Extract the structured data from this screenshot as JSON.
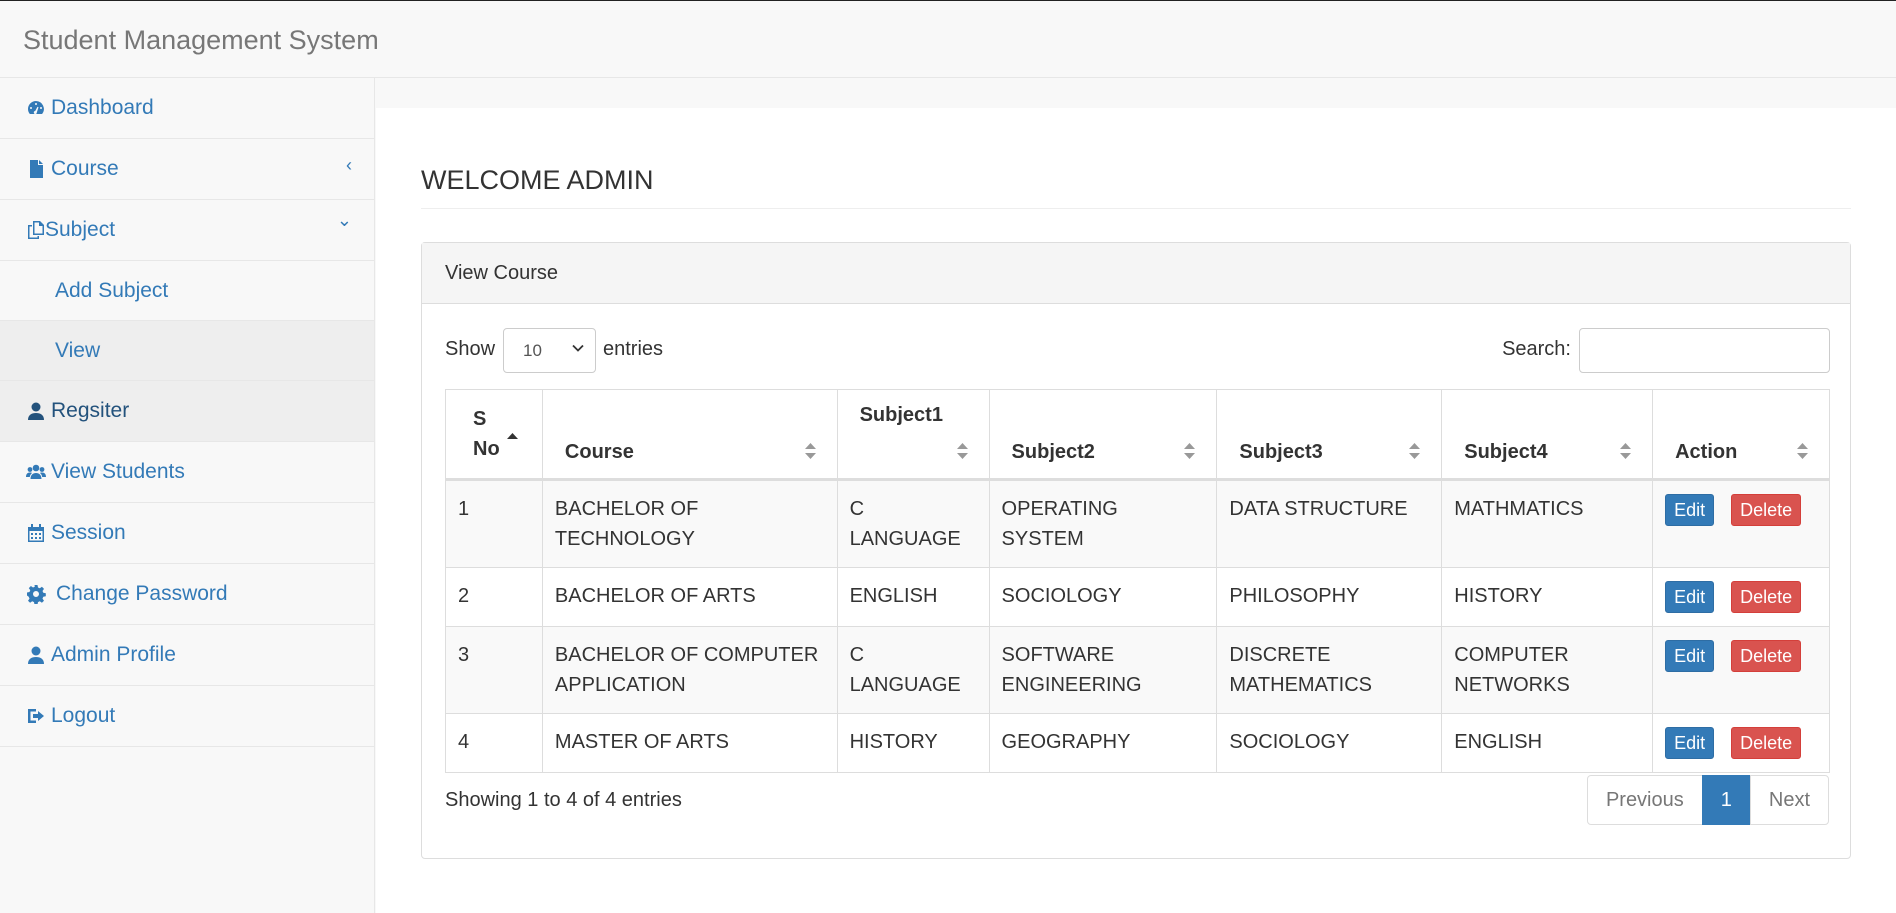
{
  "app": {
    "title": "Student Management System"
  },
  "sidebar": {
    "items": [
      {
        "label": "Dashboard",
        "icon": "dashboard-icon"
      },
      {
        "label": "Course",
        "icon": "file-icon",
        "arrow": "‹"
      },
      {
        "label": "Subject",
        "icon": "copy-icon",
        "arrow": "⌄"
      },
      {
        "label": "Regsiter",
        "icon": "user-icon"
      },
      {
        "label": "View Students",
        "icon": "users-icon"
      },
      {
        "label": "Session",
        "icon": "calendar-icon"
      },
      {
        "label": "Change Password",
        "icon": "gear-icon"
      },
      {
        "label": "Admin Profile",
        "icon": "user-icon"
      },
      {
        "label": "Logout",
        "icon": "sign-out-icon"
      }
    ],
    "subject_children": [
      {
        "label": "Add Subject"
      },
      {
        "label": "View"
      }
    ]
  },
  "main": {
    "heading": "WELCOME ADMIN",
    "panel_title": "View Course",
    "length": {
      "before": "Show",
      "value": "10",
      "after": "entries"
    },
    "search": {
      "label": "Search:",
      "value": ""
    },
    "columns": [
      "S No",
      "Course",
      "Subject1",
      "Subject2",
      "Subject3",
      "Subject4",
      "Action"
    ],
    "rows": [
      [
        "1",
        "BACHELOR OF TECHNOLOGY",
        "C LANGUAGE",
        "OPERATING SYSTEM",
        "DATA STRUCTURE",
        "MATHMATICS"
      ],
      [
        "2",
        "BACHELOR OF ARTS",
        "ENGLISH",
        "SOCIOLOGY",
        "PHILOSOPHY",
        "HISTORY"
      ],
      [
        "3",
        "BACHELOR OF COMPUTER APPLICATION",
        "C LANGUAGE",
        "SOFTWARE ENGINEERING",
        "DISCRETE MATHEMATICS",
        "COMPUTER NETWORKS"
      ],
      [
        "4",
        "MASTER OF ARTS",
        "HISTORY",
        "GEOGRAPHY",
        "SOCIOLOGY",
        "ENGLISH"
      ]
    ],
    "edit_label": "Edit",
    "delete_label": "Delete",
    "info": "Showing 1 to 4 of 4 entries",
    "pagination": {
      "prev": "Previous",
      "current": "1",
      "next": "Next"
    }
  },
  "colors": {
    "link": "#337ab7",
    "danger": "#d9534f"
  }
}
